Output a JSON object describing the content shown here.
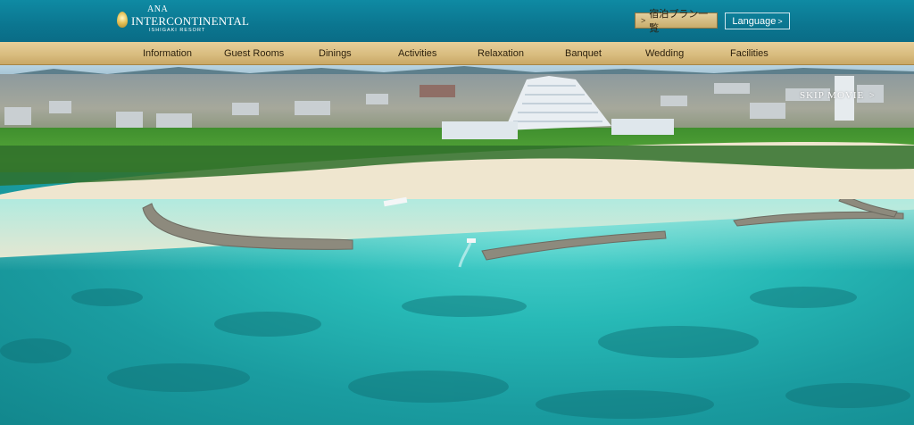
{
  "header": {
    "logo": {
      "line1": "ANA",
      "line2": "INTERCONTINENTAL",
      "line3": "ISHIGAKI RESORT"
    },
    "plan_button": "宿泊プラン一覧",
    "language_button": "Language"
  },
  "nav": {
    "items": [
      {
        "label": "Information"
      },
      {
        "label": "Guest Rooms"
      },
      {
        "label": "Dinings"
      },
      {
        "label": "Activities"
      },
      {
        "label": "Relaxation"
      },
      {
        "label": "Banquet"
      },
      {
        "label": "Wedding"
      },
      {
        "label": "Facilities"
      }
    ]
  },
  "hero": {
    "skip_label": "SKIP MOVIE"
  },
  "colors": {
    "topbar": "#0b7690",
    "nav_gold": "#d9bd80",
    "sea": "#27b9b6",
    "sand": "#efe6cf"
  }
}
